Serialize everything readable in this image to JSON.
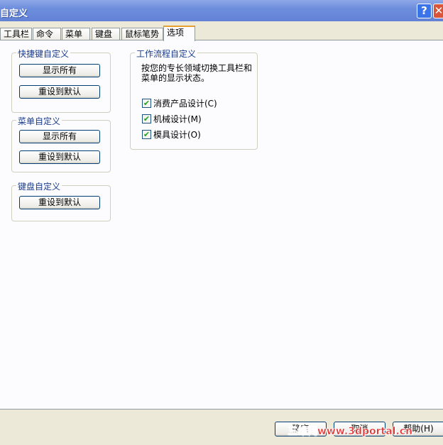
{
  "window": {
    "title": "自定义",
    "help_icon": "?",
    "close_icon": "✕"
  },
  "tabs": [
    {
      "label": "工具栏"
    },
    {
      "label": "命令"
    },
    {
      "label": "菜单"
    },
    {
      "label": "键盘"
    },
    {
      "label": "鼠标笔势"
    },
    {
      "label": "选项"
    }
  ],
  "shortcut_group": {
    "title": "快捷键自定义",
    "show_all": "显示所有",
    "reset": "重设到默认"
  },
  "menu_group": {
    "title": "菜单自定义",
    "show_all": "显示所有",
    "reset": "重设到默认"
  },
  "keyboard_group": {
    "title": "键盘自定义",
    "reset": "重设到默认"
  },
  "workflow_group": {
    "title": "工作流程自定义",
    "description": "按您的专长领域切换工具栏和菜单的显示状态。",
    "options": [
      {
        "label": "消费产品设计(C)",
        "checked": true
      },
      {
        "label": "机械设计(M)",
        "checked": true
      },
      {
        "label": "模具设计(O)",
        "checked": true
      }
    ]
  },
  "footer": {
    "ok": "确定",
    "cancel": "取消",
    "help": "帮助(H)"
  },
  "watermark": "三维网www.3dportal.cn"
}
